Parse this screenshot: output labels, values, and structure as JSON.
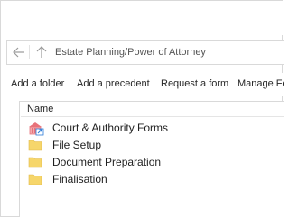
{
  "nav": {
    "breadcrumb": "Estate Planning/Power of Attorney",
    "back_icon": "back-arrow-icon",
    "up_icon": "up-arrow-icon"
  },
  "toolbar": {
    "add_folder": "Add a folder",
    "add_precedent": "Add a precedent",
    "request_form": "Request a form",
    "manage": "Manage Fo"
  },
  "list": {
    "column_header": "Name",
    "items": [
      {
        "label": "Court & Authority Forms",
        "icon": "forms-shortcut-icon"
      },
      {
        "label": "File Setup",
        "icon": "folder-icon"
      },
      {
        "label": "Document Preparation",
        "icon": "folder-icon"
      },
      {
        "label": "Finalisation",
        "icon": "folder-icon"
      }
    ]
  },
  "colors": {
    "border": "#d9d9d9",
    "folder": "#f6d66b",
    "forms_icon": "#e8727a",
    "shortcut_arrow": "#2b7bd8"
  }
}
